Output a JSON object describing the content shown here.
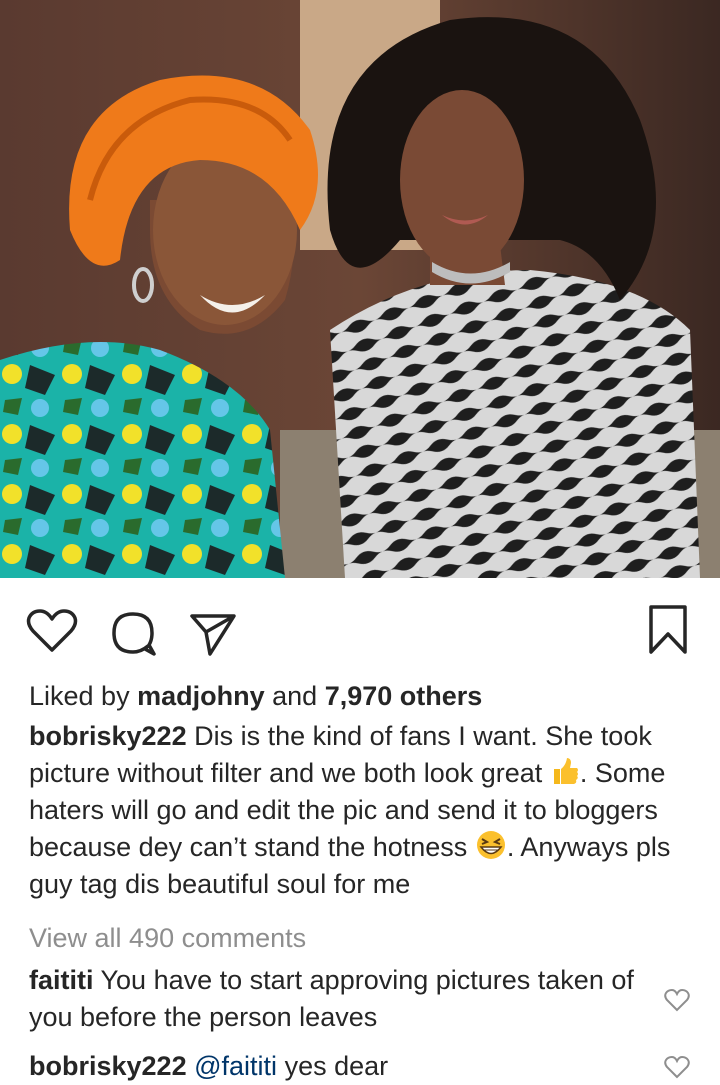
{
  "post": {
    "likes": {
      "prefix": "Liked by",
      "user": "madjohny",
      "middle": "and",
      "count": "7,970 others"
    },
    "caption": {
      "username": "bobrisky222",
      "part1": "Dis is the kind of fans I want. She took picture without filter and we both look great",
      "part2": ". Some haters will go and edit the pic and send it to bloggers because dey can’t stand the hotness",
      "part3": ". Anyways pls guy tag dis beautiful soul for me"
    },
    "view_all_comments": "View all 490 comments",
    "comments": [
      {
        "username": "faititi",
        "mention": "",
        "text": "You have to start approving pictures taken of you before the person leaves"
      },
      {
        "username": "bobrisky222",
        "mention": "@faititi",
        "text": "yes dear"
      }
    ]
  },
  "icons": [
    "heart-icon",
    "comment-icon",
    "share-icon",
    "bookmark-icon",
    "thumbs-up-emoji",
    "grinning-squinting-emoji"
  ],
  "colors": {
    "text": "#262626",
    "muted": "#8e8e8e",
    "mention": "#003569"
  }
}
